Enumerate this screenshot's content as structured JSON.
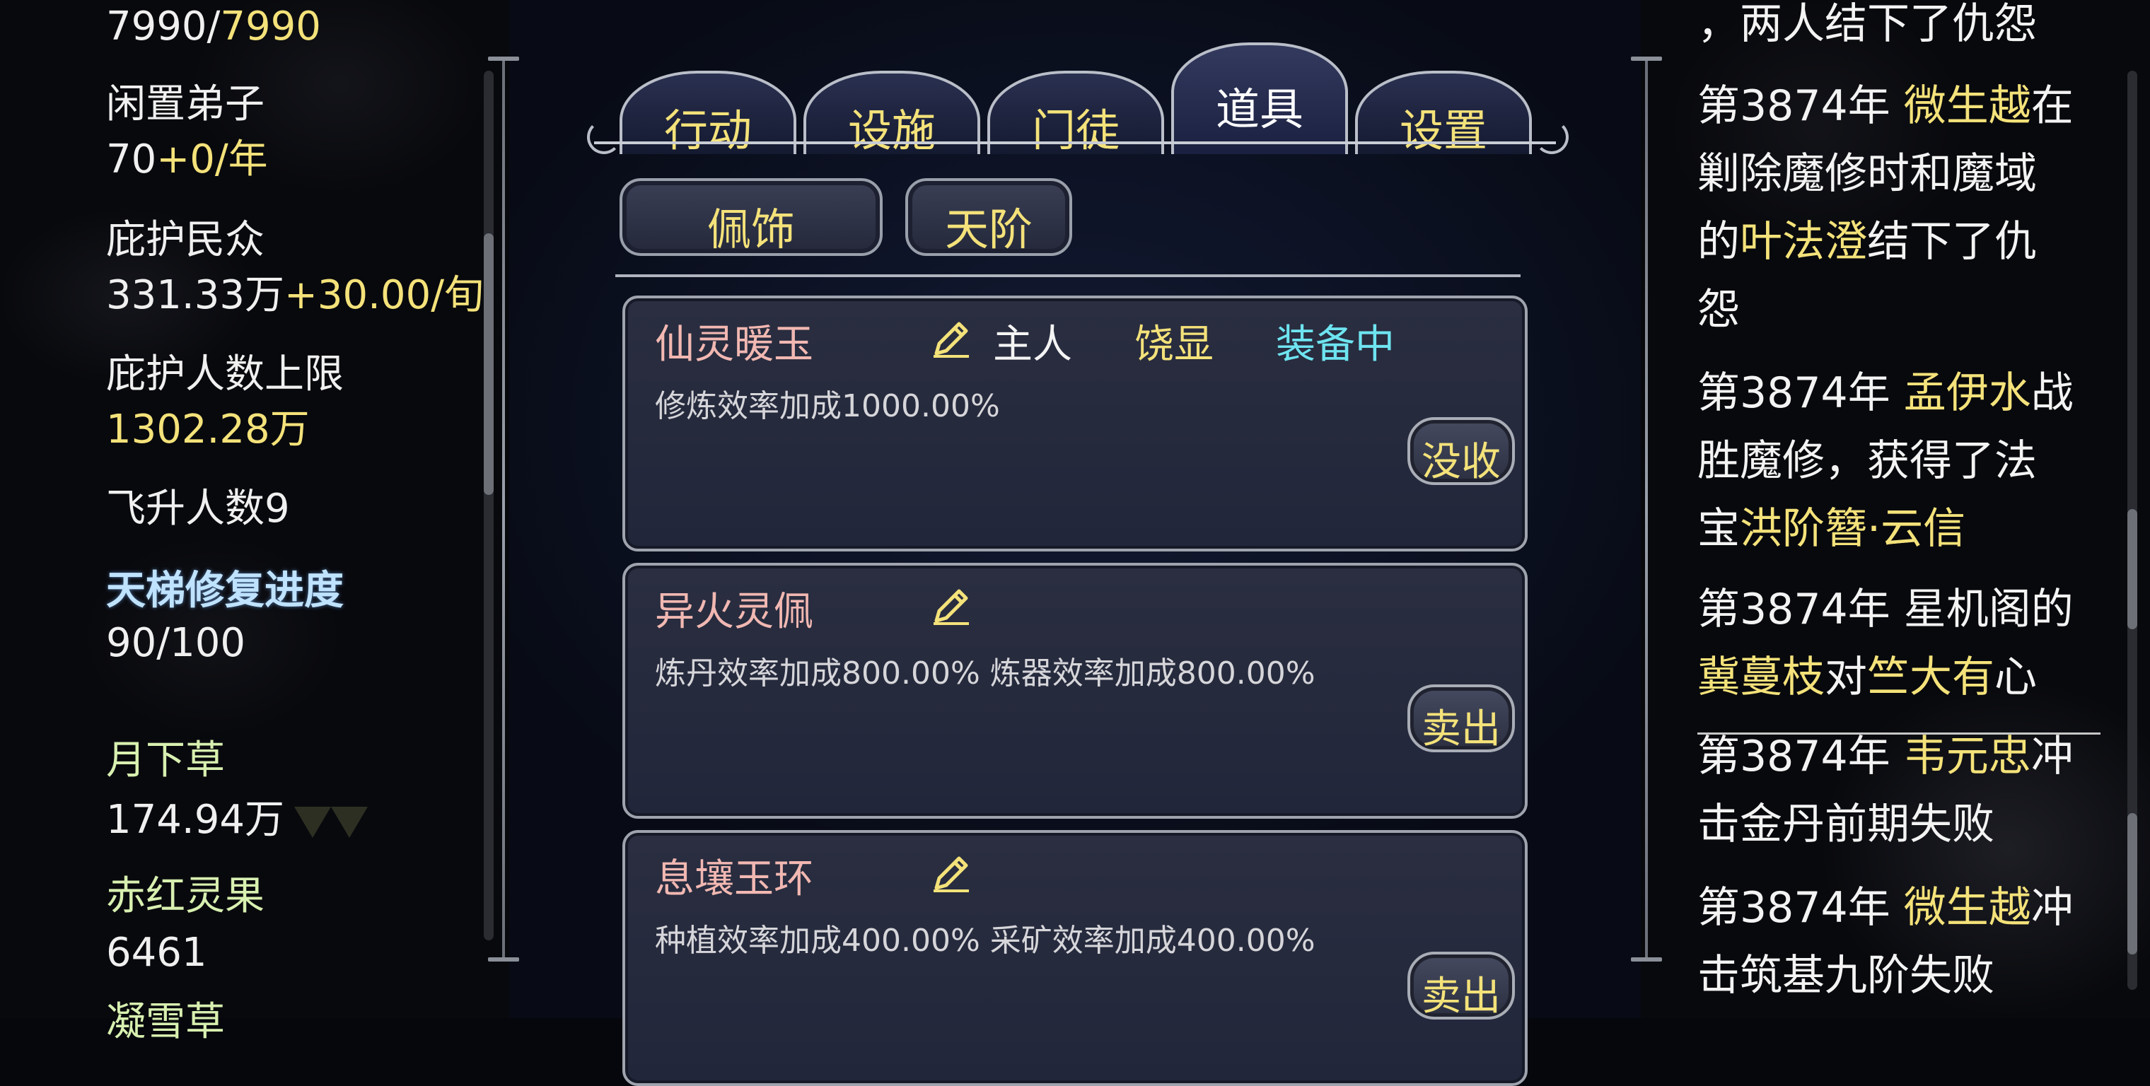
{
  "left": {
    "hp_current": "7990/",
    "hp_max": "7990",
    "idle_label": "闲置弟子",
    "idle_value": "70",
    "idle_rate": "+0/年",
    "protected_label": "庇护民众",
    "protected_value": "331.33万",
    "protected_rate": "+30.00/旬",
    "protect_cap_label": "庇护人数上限",
    "protect_cap_value": "1302.28万",
    "ascended_label": "飞升人数",
    "ascended_value": "9",
    "ladder_label": "天梯修复进度",
    "ladder_value": "90/100",
    "res1_label": "月下草",
    "res1_value": "174.94万",
    "res2_label": "赤红灵果",
    "res2_value": "6461",
    "res3_label": "凝雪草"
  },
  "tabs": [
    {
      "label": "行动",
      "active": false
    },
    {
      "label": "设施",
      "active": false
    },
    {
      "label": "门徒",
      "active": false
    },
    {
      "label": "道具",
      "active": true
    },
    {
      "label": "设置",
      "active": false
    }
  ],
  "subtabs": [
    {
      "label": "佩饰"
    },
    {
      "label": "天阶"
    }
  ],
  "items": [
    {
      "name": "仙灵暖玉",
      "owner": "主人",
      "holder": "饶显",
      "status": "装备中",
      "desc": "修炼效率加成1000.00%",
      "action": "没收"
    },
    {
      "name": "异火灵佩",
      "owner": "",
      "holder": "",
      "status": "",
      "desc": "炼丹效率加成800.00% 炼器效率加成800.00%",
      "action": "卖出"
    },
    {
      "name": "息壤玉环",
      "owner": "",
      "holder": "",
      "status": "",
      "desc": "种植效率加成400.00% 采矿效率加成400.00%",
      "action": "卖出"
    }
  ],
  "log": {
    "l0": "，两人结下了仇怨",
    "e1_a": "第3874年 ",
    "e1_b": "微生越",
    "e1_c": "在",
    "e1_d": "剿除魔修时和魔域",
    "e1_e": "的",
    "e1_f": "叶法澄",
    "e1_g": "结下了仇",
    "e1_h": "怨",
    "e2_a": "第3874年 ",
    "e2_b": "孟伊水",
    "e2_c": "战",
    "e2_d": "胜魔修，获得了法",
    "e2_e": "宝",
    "e2_f": "洪阶簪·云信",
    "e3_a": "第3874年 星机阁的",
    "e3_b": "冀蔓枝",
    "e3_c": "对",
    "e3_d": "竺大有",
    "e3_e": "心",
    "e4_a": "第3874年 ",
    "e4_b": "韦元忠",
    "e4_c": "冲",
    "e4_d": "击金丹前期失败",
    "e5_a": "第3874年 ",
    "e5_b": "微生越",
    "e5_c": "冲",
    "e5_d": "击筑基九阶失败"
  },
  "colors": {
    "accent_yellow": "#f4e27a",
    "equipped_cyan": "#6ee4f0",
    "item_name_pink": "#f2b8b2"
  }
}
